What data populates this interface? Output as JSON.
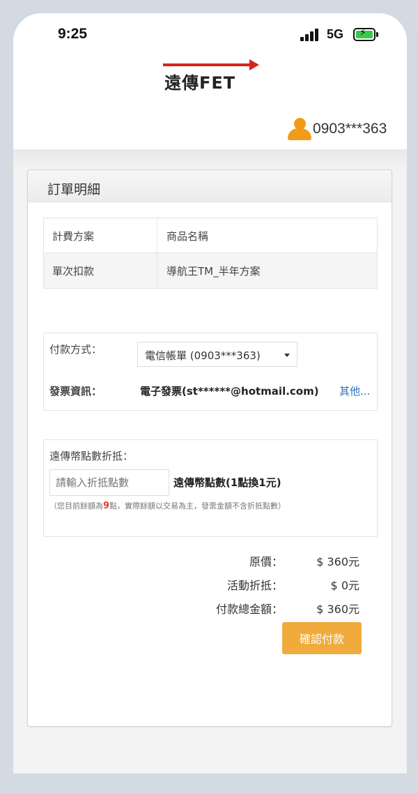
{
  "status_bar": {
    "time": "9:25",
    "network": "5G"
  },
  "header": {
    "logo_text": "遠傳FET",
    "user_phone": "0903***363"
  },
  "card": {
    "title": "訂單明細",
    "detail_table": {
      "rows": [
        [
          "計費方案",
          "商品名稱"
        ],
        [
          "單次扣款",
          "導航王TM_半年方案"
        ]
      ]
    },
    "payment": {
      "method_label": "付款方式：",
      "method_value": "電信帳單 (0903***363)",
      "invoice_label": "發票資訊：",
      "invoice_value": "電子發票(st******@hotmail.com)",
      "invoice_other_link": "其他..."
    },
    "points": {
      "title": "遠傳幣點數折抵：",
      "input_placeholder": "請輸入折抵點數",
      "rate_text": "遠傳幣點數(1點換1元)",
      "note_prefix": "（您目前餘額為",
      "note_number": "9",
      "note_suffix": "點，實際餘額以交易為主，發票金額不含折抵點數）"
    },
    "summary": {
      "original_label": "原價：",
      "original_value": "$ 360元",
      "discount_label": "活動折抵：",
      "discount_value": "$ 0元",
      "total_label": "付款總金額：",
      "total_value": "$ 360元"
    },
    "confirm_button": "確認付款"
  },
  "colors": {
    "accent_orange": "#f0ab3c",
    "user_icon": "#f29b1a",
    "logo_red": "#d4261c",
    "link_blue": "#2a6ebb",
    "highlight_red": "#e23a2c"
  }
}
